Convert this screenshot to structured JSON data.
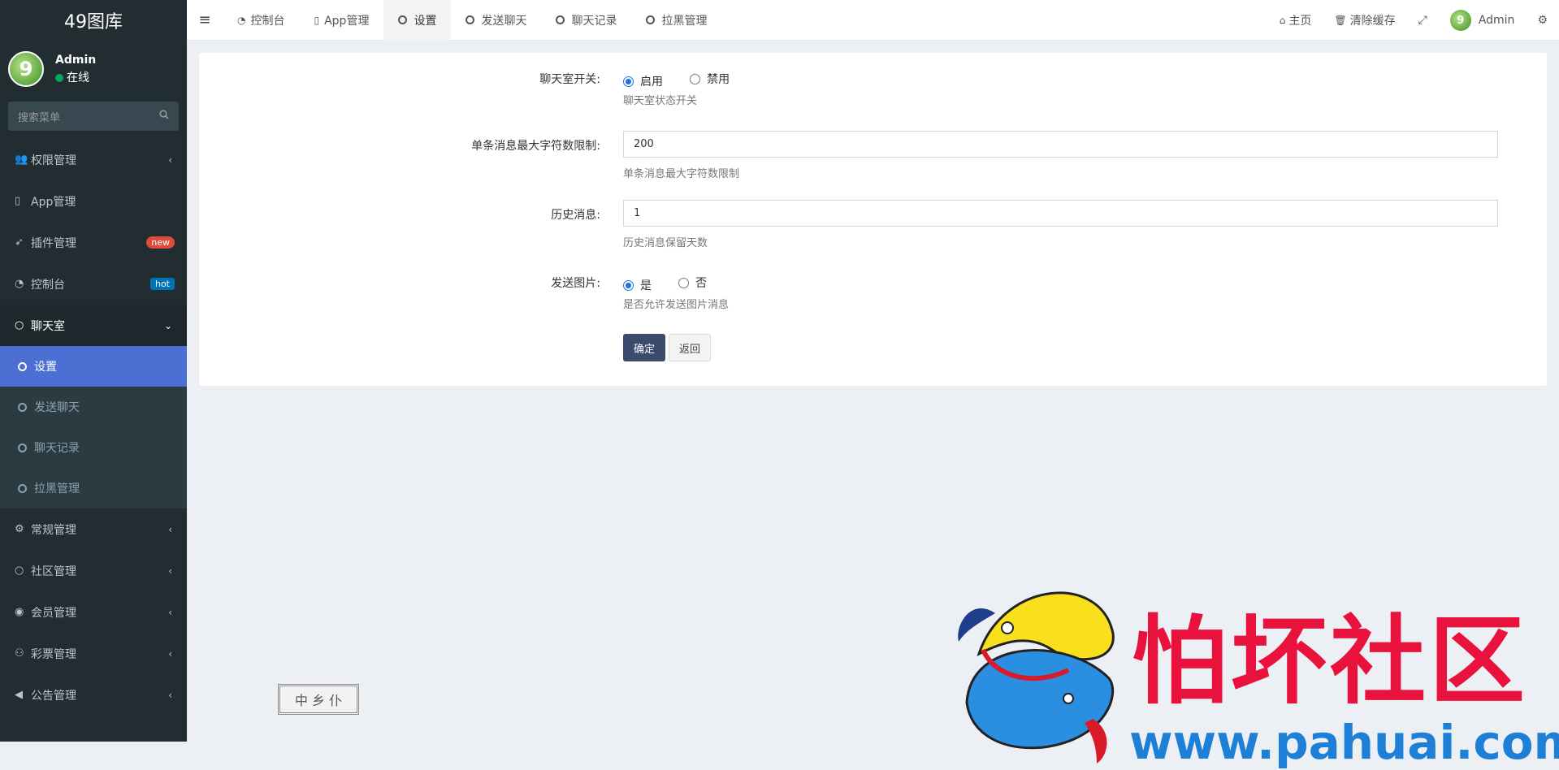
{
  "app": {
    "logo": "49图库"
  },
  "user": {
    "name": "Admin",
    "status": "在线",
    "avatar_text": "9"
  },
  "sidebar": {
    "search_placeholder": "搜索菜单",
    "items": [
      {
        "label": "权限管理",
        "icon": "users-icon"
      },
      {
        "label": "App管理",
        "icon": "file-icon"
      },
      {
        "label": "插件管理",
        "icon": "rocket-icon",
        "badge": "new"
      },
      {
        "label": "控制台",
        "icon": "dashboard-icon",
        "badge": "hot"
      },
      {
        "label": "聊天室",
        "icon": "circle-icon"
      },
      {
        "label": "常规管理",
        "icon": "cogs-icon"
      },
      {
        "label": "社区管理",
        "icon": "circle-icon"
      },
      {
        "label": "会员管理",
        "icon": "user-circle-icon"
      },
      {
        "label": "彩票管理",
        "icon": "gamepad-icon"
      },
      {
        "label": "公告管理",
        "icon": "volume-icon"
      }
    ],
    "submenu": [
      {
        "label": "设置"
      },
      {
        "label": "发送聊天"
      },
      {
        "label": "聊天记录"
      },
      {
        "label": "拉黑管理"
      }
    ]
  },
  "tabs": [
    {
      "label": "控制台",
      "icon": "dashboard-icon"
    },
    {
      "label": "App管理",
      "icon": "file-icon"
    },
    {
      "label": "设置",
      "icon": "circle-icon"
    },
    {
      "label": "发送聊天",
      "icon": "circle-icon"
    },
    {
      "label": "聊天记录",
      "icon": "circle-icon"
    },
    {
      "label": "拉黑管理",
      "icon": "circle-icon"
    }
  ],
  "topright": {
    "home": "主页",
    "clear_cache": "清除缓存",
    "user": "Admin"
  },
  "form": {
    "chat_switch": {
      "label": "聊天室开关:",
      "opt_on": "启用",
      "opt_off": "禁用",
      "help": "聊天室状态开关",
      "selected": "启用"
    },
    "max_chars": {
      "label": "单条消息最大字符数限制:",
      "value": "200",
      "help": "单条消息最大字符数限制"
    },
    "history": {
      "label": "历史消息:",
      "value": "1",
      "help": "历史消息保留天数"
    },
    "send_image": {
      "label": "发送图片:",
      "opt_yes": "是",
      "opt_no": "否",
      "help": "是否允许发送图片消息",
      "selected": "是"
    },
    "submit": "确定",
    "back": "返回"
  },
  "stamp": {
    "text": "中 乡 仆"
  },
  "watermark": {
    "text": "怕坏社区",
    "url": "www.pahuai.com"
  },
  "colors": {
    "sidebar_bg": "#222d32",
    "active_item": "#4b6fd3",
    "primary_button": "#3c4b6b",
    "badge_new": "#dd4b39",
    "badge_hot": "#0073b7"
  }
}
